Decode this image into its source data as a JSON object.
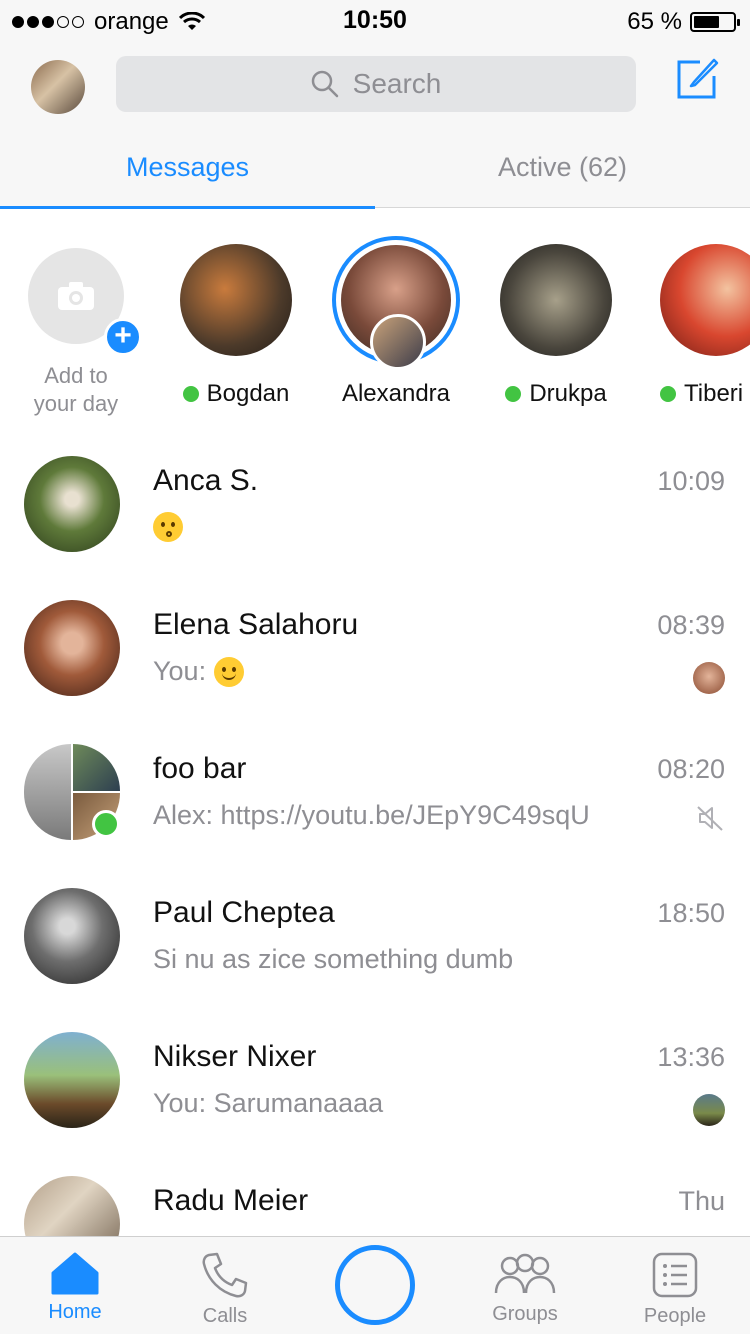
{
  "status_bar": {
    "carrier": "orange",
    "time": "10:50",
    "battery_text": "65 %",
    "battery_level": 0.65
  },
  "header": {
    "search": {
      "placeholder": "Search"
    },
    "tabs": [
      {
        "label": "Messages"
      },
      {
        "label": "Active (62)"
      }
    ]
  },
  "stories": {
    "add": {
      "label": "Add to your day"
    },
    "items": [
      {
        "name": "Bogdan",
        "online": true
      },
      {
        "name": "Alexandra",
        "online": false,
        "ring": true
      },
      {
        "name": "Drukpa",
        "online": true
      },
      {
        "name": "Tiberi",
        "online": true
      }
    ]
  },
  "conversations": [
    {
      "name": "Anca S.",
      "time": "10:09",
      "preview": "",
      "emoji": "kissing-face"
    },
    {
      "name": "Elena Salahoru",
      "time": "08:39",
      "preview": "You:",
      "emoji": "smiling-face"
    },
    {
      "name": "foo bar",
      "time": "08:20",
      "preview": "Alex: https://youtu.be/JEpY9C49sqU",
      "muted": true
    },
    {
      "name": "Paul Cheptea",
      "time": "18:50",
      "preview": "Si nu as zice something dumb"
    },
    {
      "name": "Nikser Nixer",
      "time": "13:36",
      "preview": "You: Sarumanaaaa"
    },
    {
      "name": "Radu Meier",
      "time": "Thu",
      "preview": ""
    }
  ],
  "tab_bar": {
    "items": [
      {
        "label": "Home",
        "icon": "home-icon",
        "active": true
      },
      {
        "label": "Calls",
        "icon": "phone-icon"
      },
      {
        "label": "",
        "icon": "camera-capture-icon"
      },
      {
        "label": "Groups",
        "icon": "groups-icon"
      },
      {
        "label": "People",
        "icon": "people-list-icon"
      }
    ]
  },
  "colors": {
    "accent": "#1a8cff",
    "online": "#42c442",
    "secondary_text": "#8e8e93"
  }
}
